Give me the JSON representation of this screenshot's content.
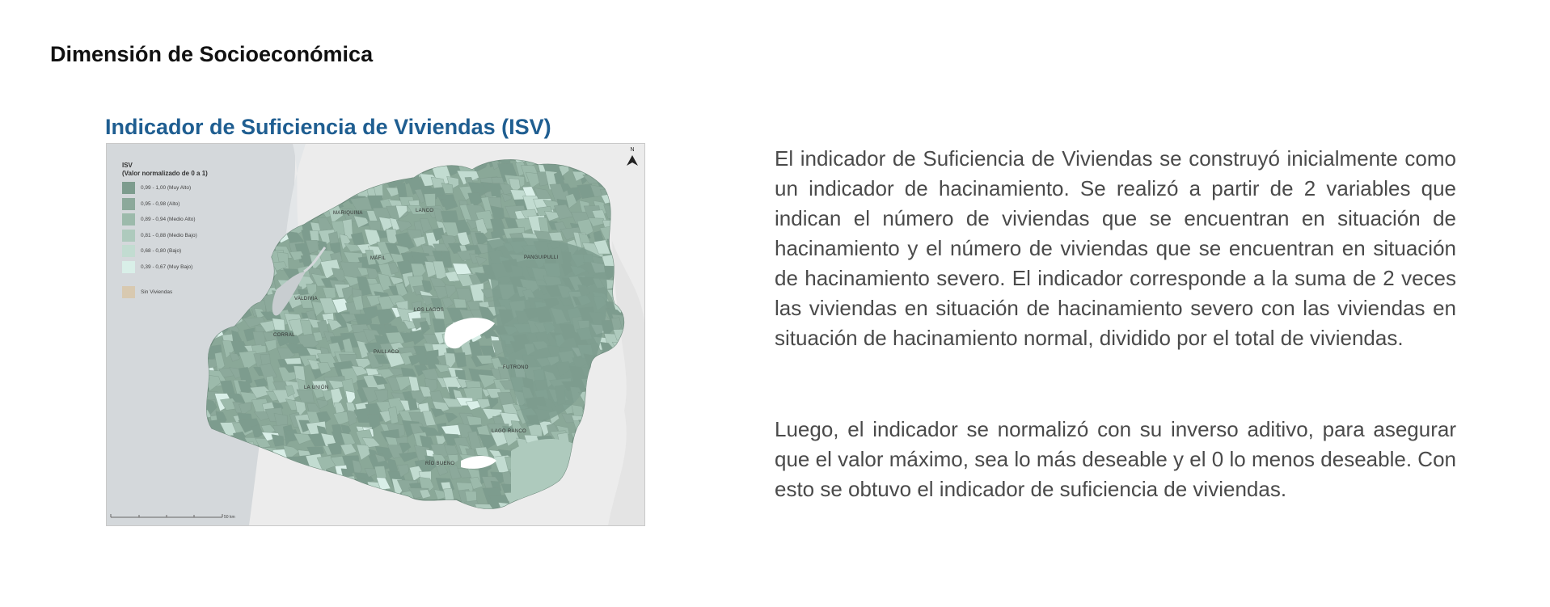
{
  "section_title": "Dimensión de Socioeconómica",
  "map_title": "Indicador de Suficiencia de Viviendas (ISV)",
  "legend": {
    "title": "ISV",
    "subtitle": "(Valor normalizado de 0 a 1)",
    "classes": [
      {
        "label": "0,99 - 1,00 (Muy Alto)",
        "color": "#7d9c8e"
      },
      {
        "label": "0,95 - 0,98 (Alto)",
        "color": "#8ca99b"
      },
      {
        "label": "0,89 - 0,94 (Medio Alto)",
        "color": "#9cbaab"
      },
      {
        "label": "0,81 - 0,88 (Medio Bajo)",
        "color": "#aecabd"
      },
      {
        "label": "0,68 - 0,80 (Bajo)",
        "color": "#c2dcd1"
      },
      {
        "label": "0,39 - 0,67 (Muy Bajo)",
        "color": "#d9efe8"
      }
    ],
    "no_data": {
      "label": "Sin Viviendas",
      "color": "#d8c9b0"
    }
  },
  "places": [
    "MARIQUINA",
    "LANCO",
    "MÁFIL",
    "PANGUIPULLI",
    "VALDIVIA",
    "LOS LAGOS",
    "CORRAL",
    "PAILLACO",
    "FUTRONO",
    "LA UNIÓN",
    "LAGO RANCO",
    "RÍO BUENO"
  ],
  "north_label": "N",
  "scale_label": "50 km",
  "description": {
    "paragraph_1": "El indicador de Suficiencia de Viviendas se construyó inicialmente como un indicador de hacinamiento. Se realizó a partir de 2 variables que indican el número de viviendas que se encuentran en situación de hacinamiento y el número de viviendas que se encuentran en situación de hacinamiento severo. El indicador corresponde a la suma de 2 veces las viviendas en situación de hacinamiento severo con las viviendas en situación de hacinamiento normal, dividido por el total de viviendas.",
    "paragraph_2": "Luego, el indicador se normalizó con su inverso aditivo, para asegurar que el valor máximo, sea lo más deseable y el 0 lo menos deseable. Con esto se obtuvo el indicador de suficiencia de viviendas."
  },
  "colors": {
    "sea": "#d4d8db",
    "land": "#ececec",
    "region_base": "#8aa898",
    "lake": "#ffffff",
    "title_blue": "#1f5e91"
  }
}
